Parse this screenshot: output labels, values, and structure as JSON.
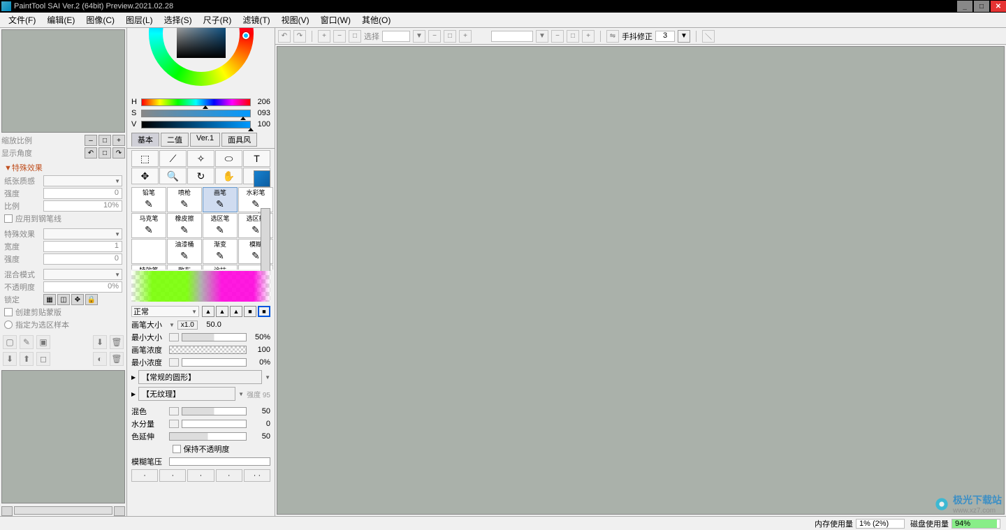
{
  "title": "PaintTool SAI Ver.2 (64bit) Preview.2021.02.28",
  "menu": [
    "文件(F)",
    "编辑(E)",
    "图像(C)",
    "图层(L)",
    "选择(S)",
    "尺子(R)",
    "滤镜(T)",
    "视图(V)",
    "窗口(W)",
    "其他(O)"
  ],
  "zoom_label": "缩放比例",
  "angle_label": "显示角度",
  "effects": {
    "header": "▼特殊效果",
    "paper": "纸张质感",
    "strength": "强度",
    "strength_val": "0",
    "ratio": "比例",
    "ratio_val": "10%",
    "apply_pen": "应用到钢笔线",
    "effect": "特殊效果",
    "width": "宽度",
    "width_val": "1",
    "strength2": "强度",
    "strength2_val": "0",
    "blend": "混合模式",
    "opacity": "不透明度",
    "opacity_val": "0%",
    "lock": "锁定",
    "clip": "创建剪贴蒙版",
    "sel_source": "指定为选区样本"
  },
  "hsv": {
    "h": "206",
    "s": "093",
    "v": "100"
  },
  "palette_tabs": [
    "基本",
    "二值",
    "Ver.1",
    "面具风"
  ],
  "brushes": [
    "铅笔",
    "喷枪",
    "画笔",
    "水彩笔",
    "马克笔",
    "橡皮擦",
    "选区笔",
    "选区擦",
    "",
    "油漆桶",
    "渐变",
    "模糊",
    "特效笔",
    "散布",
    "涂抹",
    ""
  ],
  "brush_selected_idx": 2,
  "shape_mode": "正常",
  "brush_opts": {
    "size": "画笔大小",
    "size_x": "x1.0",
    "size_val": "50.0",
    "min_size": "最小大小",
    "min_size_val": "50%",
    "density": "画笔浓度",
    "density_val": "100",
    "min_density": "最小浓度",
    "min_density_val": "0%",
    "shape_sel": "【常规的圆形】",
    "texture_sel": "【无纹理】",
    "texture_extra": "强度    95",
    "blend": "混色",
    "blend_val": "50",
    "water": "水分量",
    "water_val": "0",
    "persist": "色延伸",
    "persist_val": "50",
    "keep_opacity": "保持不透明度",
    "blur_pressure": "模糊笔压"
  },
  "canvas_toolbar": {
    "select": "选择",
    "stabilizer": "手抖修正",
    "stabilizer_val": "3"
  },
  "status": {
    "mem_label": "内存使用量",
    "mem_val": "1% (2%)",
    "disk_label": "磁盘使用量",
    "disk_val": "94%"
  },
  "watermark": {
    "text": "极光下载站",
    "url": "www.xz7.com"
  }
}
